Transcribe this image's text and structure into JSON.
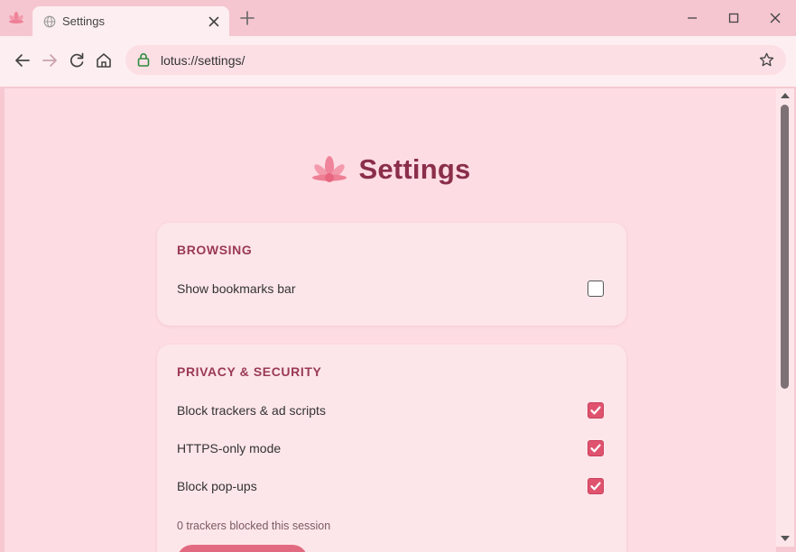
{
  "tab": {
    "title": "Settings"
  },
  "toolbar": {
    "url": "lotus://settings/"
  },
  "page": {
    "title": "Settings"
  },
  "sections": {
    "browsing": {
      "title": "BROWSING",
      "items": [
        {
          "label": "Show bookmarks bar",
          "checked": false
        }
      ]
    },
    "privacy": {
      "title": "PRIVACY & SECURITY",
      "items": [
        {
          "label": "Block trackers & ad scripts",
          "checked": true
        },
        {
          "label": "HTTPS-only mode",
          "checked": true
        },
        {
          "label": "Block pop-ups",
          "checked": true
        }
      ],
      "status": "0 trackers blocked this session"
    }
  },
  "colors": {
    "accent": "#e0536e",
    "title": "#8a2e4a",
    "tabbar": "#f5c6d0"
  },
  "icons": {
    "app": "lotus-icon",
    "tab": "globe-icon",
    "close": "close-icon",
    "newtab": "plus-icon",
    "back": "back-arrow-icon",
    "forward": "forward-arrow-icon",
    "reload": "reload-icon",
    "home": "home-icon",
    "lock": "lock-icon",
    "bookmark": "star-icon"
  }
}
